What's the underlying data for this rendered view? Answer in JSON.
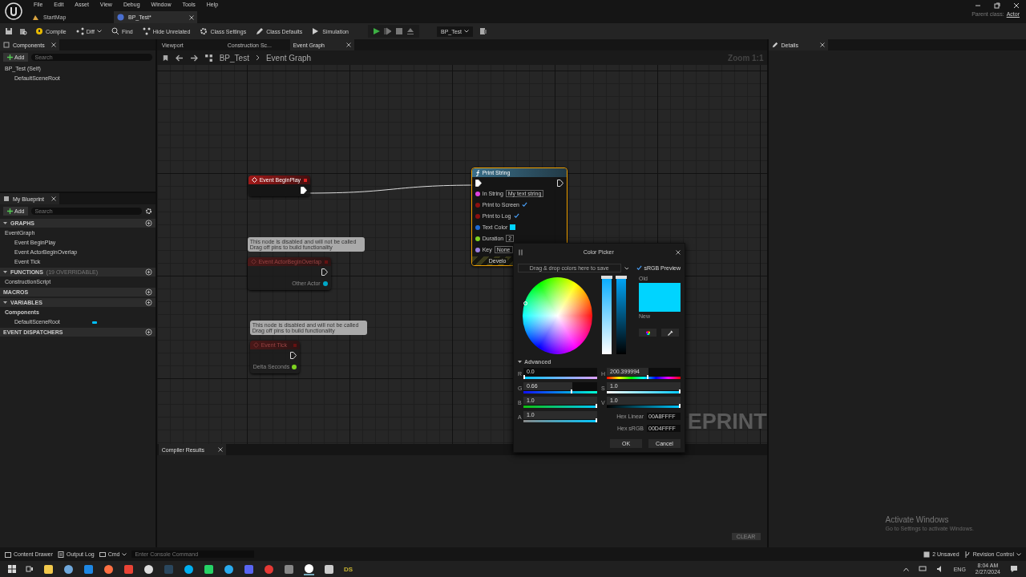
{
  "menu": [
    "File",
    "Edit",
    "Asset",
    "View",
    "Debug",
    "Window",
    "Tools",
    "Help"
  ],
  "doc_tabs": [
    {
      "label": "StartMap",
      "selected": false
    },
    {
      "label": "BP_Test*",
      "selected": true
    }
  ],
  "parent_class": {
    "label": "Parent class:",
    "value": "Actor"
  },
  "toolbar": {
    "items": [
      "Compile",
      "Diff",
      "Find",
      "Hide Unrelated",
      "Class Settings",
      "Class Defaults",
      "Simulation"
    ],
    "debug_object": "BP_Test"
  },
  "components_panel": {
    "title": "Components",
    "add": "Add",
    "search_placeholder": "Search",
    "tree": [
      {
        "label": "BP_Test (Self)",
        "children": [
          {
            "label": "DefaultSceneRoot"
          }
        ]
      }
    ]
  },
  "my_blueprint": {
    "title": "My Blueprint",
    "add": "Add",
    "search_placeholder": "Search",
    "sections": [
      {
        "title": "GRAPHS",
        "expanded": true,
        "items": [
          {
            "label": "EventGraph",
            "children": [
              {
                "label": "Event BeginPlay"
              },
              {
                "label": "Event ActorBeginOverlap"
              },
              {
                "label": "Event Tick"
              }
            ]
          }
        ]
      },
      {
        "title": "FUNCTIONS",
        "note": "(19 OVERRIDABLE)",
        "expanded": true,
        "items": [
          {
            "label": "ConstructionScript"
          }
        ]
      },
      {
        "title": "MACROS",
        "expanded": false
      },
      {
        "title": "VARIABLES",
        "expanded": true,
        "items": [
          {
            "label": "Components",
            "children": [
              {
                "label": "DefaultSceneRoot"
              }
            ]
          }
        ]
      },
      {
        "title": "EVENT DISPATCHERS",
        "expanded": false
      }
    ]
  },
  "graph_tabs": [
    {
      "label": "Viewport",
      "selected": false
    },
    {
      "label": "Construction Sc...",
      "selected": false
    },
    {
      "label": "Event Graph",
      "selected": true
    }
  ],
  "breadcrumb": [
    "BP_Test",
    "Event Graph"
  ],
  "zoom": "Zoom 1:1",
  "nodes": [
    {
      "kind": "event",
      "title": "Event BeginPlay",
      "disabled": false
    },
    {
      "kind": "event",
      "title": "Event ActorBeginOverlap",
      "disabled": true,
      "note": [
        "This node is disabled and will not be called",
        "Drag off pins to build functionality"
      ],
      "outputs": [
        {
          "label": "Other Actor",
          "color": "#00a8c8"
        }
      ]
    },
    {
      "kind": "event",
      "title": "Event Tick",
      "disabled": true,
      "note": [
        "This node is disabled and will not be called",
        "Drag off pins to build functionality"
      ],
      "outputs": [
        {
          "label": "Delta Seconds",
          "color": "#7ed321"
        }
      ]
    },
    {
      "kind": "function",
      "title": "Print String",
      "disabled": false,
      "footer": "Develo",
      "inputs": [
        {
          "kind": "text",
          "label": "In String",
          "color": "#e040e0",
          "value": "My text string"
        },
        {
          "kind": "bool",
          "label": "Print to Screen",
          "color": "#8b1010",
          "checked": true
        },
        {
          "kind": "bool",
          "label": "Print to Log",
          "color": "#8b1010",
          "checked": true
        },
        {
          "kind": "color",
          "label": "Text Color",
          "color": "#1e6bd6",
          "swatch": {
            "color": "#00d4ff"
          }
        },
        {
          "kind": "text",
          "label": "Duration",
          "color": "#7ed321",
          "value": "2"
        },
        {
          "kind": "text",
          "label": "Key",
          "color": "#9b7fe0",
          "value": "None"
        }
      ]
    }
  ],
  "graph_label": "EPRINT",
  "color_picker": {
    "title": "Color Picker",
    "saved_placeholder": "Drag & drop colors here to save",
    "srgb_preview": {
      "label": "sRGB Preview",
      "checked": true
    },
    "old": {
      "label": "Old",
      "color": "#00d4ff"
    },
    "new": {
      "label": "New",
      "color": "#00d4ff"
    },
    "advanced": {
      "label": "Advanced",
      "expanded": true
    },
    "saturation_slider": {
      "level": 1
    },
    "value_slider": {
      "level": 1
    },
    "left_fields": [
      {
        "label": "R",
        "value": "0.0",
        "level": 0
      },
      {
        "label": "G",
        "value": "0.66",
        "level": 0.66
      },
      {
        "label": "B",
        "value": "1.0",
        "level": 1
      },
      {
        "label": "A",
        "value": "1.0",
        "level": 1
      }
    ],
    "right_fields": [
      {
        "label": "H",
        "value": "200.399994",
        "level": 0.56
      },
      {
        "label": "S",
        "value": "1.0",
        "level": 1
      },
      {
        "label": "V",
        "value": "1.0",
        "level": 1
      }
    ],
    "hex": [
      {
        "label": "Hex Linear",
        "value": "00A8FFFF"
      },
      {
        "label": "Hex sRGB",
        "value": "00D4FFFF"
      }
    ],
    "buttons": [
      "OK",
      "Cancel"
    ]
  },
  "compiler_results": {
    "title": "Compiler Results",
    "clear": "CLEAR"
  },
  "details": {
    "title": "Details"
  },
  "activation_notice": {
    "title": "Activate Windows",
    "text": "Go to Settings to activate Windows."
  },
  "status_bar": {
    "content_drawer": "Content Drawer",
    "output_log": "Output Log",
    "cmd": "Cmd",
    "console_placeholder": "Enter Console Command",
    "unsaved": "2 Unsaved",
    "revision_control": "Revision Control"
  },
  "taskbar": {
    "app_label": "DS",
    "language": "ENG",
    "time": "8:04 AM",
    "date": "2/27/2024"
  }
}
